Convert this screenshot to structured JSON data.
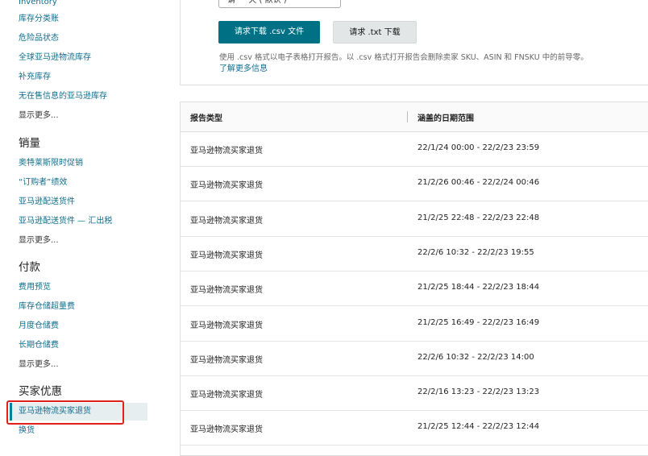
{
  "sidebar": {
    "inventory_section": [
      {
        "label": "Inventory"
      },
      {
        "label": "库存分类账"
      },
      {
        "label": "危险品状态"
      },
      {
        "label": "全球亚马逊物流库存"
      },
      {
        "label": "补充库存"
      },
      {
        "label": "无在售信息的亚马逊库存"
      }
    ],
    "inventory_more": "显示更多...",
    "sales_heading": "销量",
    "sales_section": [
      {
        "label": "奥特莱斯限时促销"
      },
      {
        "label": "“订购者”绩效"
      },
      {
        "label": "亚马逊配送货件"
      },
      {
        "label": "亚马逊配送货件 — 汇出税"
      }
    ],
    "sales_more": "显示更多...",
    "payments_heading": "付款",
    "payments_section": [
      {
        "label": "费用预览"
      },
      {
        "label": "库存仓储超量费"
      },
      {
        "label": "月度仓储费"
      },
      {
        "label": "长期仓储费"
      }
    ],
    "payments_more": "显示更多...",
    "buyer_heading": "买家优惠",
    "buyer_section": [
      {
        "label": "亚马逊物流买家退货"
      },
      {
        "label": "换货"
      }
    ]
  },
  "request_panel": {
    "dropdown_value": "请 一 天 ( 默认 )",
    "csv_button": "请求下载 .csv 文件",
    "txt_button": "请求 .txt 下载",
    "hint": "使用 .csv 格式以电子表格打开报告。以 .csv 格式打开报告会删除卖家 SKU、ASIN 和 FNSKU 中的前导零。",
    "learn_more": "了解更多信息"
  },
  "table": {
    "headers": {
      "type": "报告类型",
      "range": "涵盖的日期范围"
    },
    "rows": [
      {
        "type": "亚马逊物流买家退货",
        "range": "22/1/24 00:00 - 22/2/23 23:59"
      },
      {
        "type": "亚马逊物流买家退货",
        "range": "21/2/26 00:46 - 22/2/24 00:46"
      },
      {
        "type": "亚马逊物流买家退货",
        "range": "21/2/25 22:48 - 22/2/23 22:48"
      },
      {
        "type": "亚马逊物流买家退货",
        "range": "22/2/6 10:32 - 22/2/23 19:55"
      },
      {
        "type": "亚马逊物流买家退货",
        "range": "21/2/25 18:44 - 22/2/23 18:44"
      },
      {
        "type": "亚马逊物流买家退货",
        "range": "21/2/25 16:49 - 22/2/23 16:49"
      },
      {
        "type": "亚马逊物流买家退货",
        "range": "22/2/6 10:32 - 22/2/23 14:00"
      },
      {
        "type": "亚马逊物流买家退货",
        "range": "22/2/16 13:23 - 22/2/23 13:23"
      },
      {
        "type": "亚马逊物流买家退货",
        "range": "21/2/25 12:44 - 22/2/23 12:44"
      }
    ]
  },
  "colors": {
    "accent": "#007185",
    "link": "#0f6e8c",
    "highlight_box": "#e02020"
  }
}
